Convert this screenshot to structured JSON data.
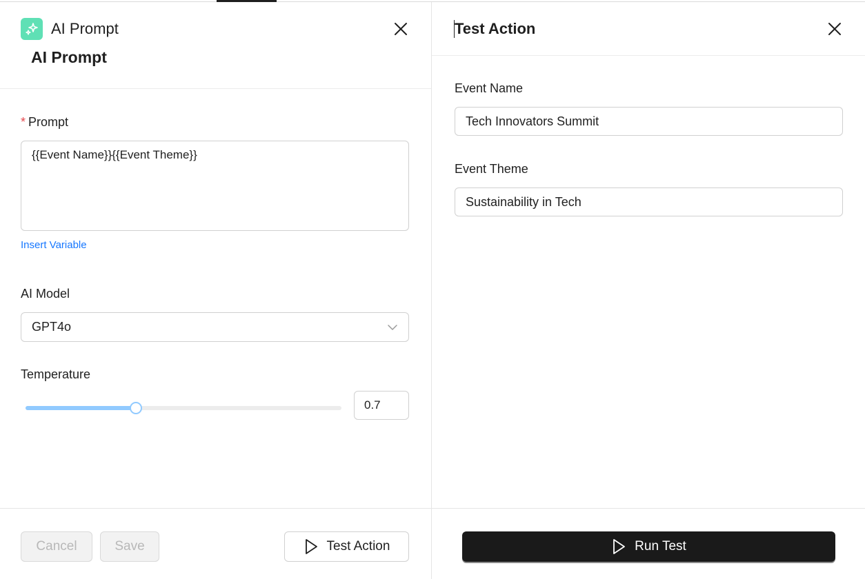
{
  "left_panel": {
    "title_small": "AI Prompt",
    "title_large": "AI Prompt",
    "prompt": {
      "required_mark": "*",
      "label": "Prompt",
      "value": "{{Event Name}}{{Event Theme}}"
    },
    "insert_variable_label": "Insert Variable",
    "model": {
      "label": "AI Model",
      "selected": "GPT4o"
    },
    "temperature": {
      "label": "Temperature",
      "value": "0.7",
      "slider_fraction": 0.35
    },
    "footer": {
      "cancel_label": "Cancel",
      "save_label": "Save",
      "test_action_label": "Test Action"
    }
  },
  "right_panel": {
    "title": "Test Action",
    "fields": [
      {
        "label": "Event Name",
        "value": "Tech Innovators Summit"
      },
      {
        "label": "Event Theme",
        "value": "Sustainability in Tech"
      }
    ],
    "run_test_label": "Run Test"
  },
  "colors": {
    "accent_icon": "#5fe0b5",
    "link": "#1677ff",
    "required": "#e5484d",
    "slider": "#91caff",
    "primary_button": "#1a1a1a"
  },
  "icons": [
    "sparkle-icon",
    "close-icon",
    "chevron-down-icon",
    "play-icon"
  ]
}
